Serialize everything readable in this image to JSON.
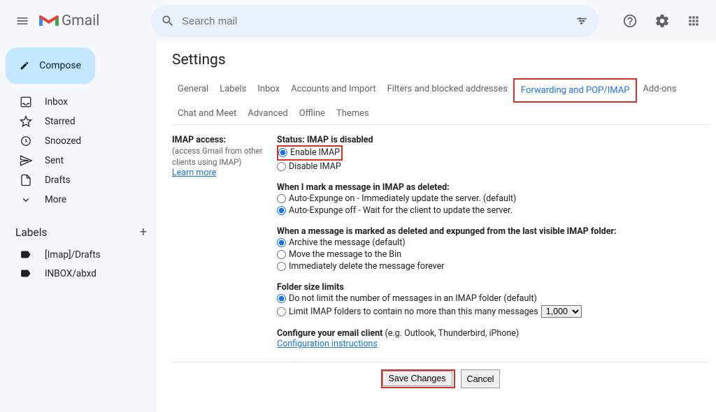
{
  "header": {
    "logo_text": "Gmail",
    "search_placeholder": "Search mail"
  },
  "compose_label": "Compose",
  "nav": {
    "inbox": "Inbox",
    "starred": "Starred",
    "snoozed": "Snoozed",
    "sent": "Sent",
    "drafts": "Drafts",
    "more": "More"
  },
  "labels_header": "Labels",
  "labels": {
    "imap_drafts": "[Imap]/Drafts",
    "inbox_abxd": "INBOX/abxd"
  },
  "settings_title": "Settings",
  "tabs": {
    "general": "General",
    "labels": "Labels",
    "inbox": "Inbox",
    "accounts": "Accounts and Import",
    "filters": "Filters and blocked addresses",
    "forwarding": "Forwarding and POP/IMAP",
    "addons": "Add-ons",
    "chat": "Chat and Meet",
    "advanced": "Advanced",
    "offline": "Offline",
    "themes": "Themes"
  },
  "imap": {
    "section_label": "IMAP access:",
    "section_hint": "(access Gmail from other clients using IMAP)",
    "learn_more": "Learn more",
    "status": "Status: IMAP is disabled",
    "enable": "Enable IMAP",
    "disable": "Disable IMAP",
    "deleted_header": "When I mark a message in IMAP as deleted:",
    "auto_on": "Auto-Expunge on - Immediately update the server. (default)",
    "auto_off": "Auto-Expunge off - Wait for the client to update the server.",
    "expunge_header": "When a message is marked as deleted and expunged from the last visible IMAP folder:",
    "archive": "Archive the message (default)",
    "move_bin": "Move the message to the Bin",
    "delete_forever": "Immediately delete the message forever",
    "folder_header": "Folder size limits",
    "no_limit": "Do not limit the number of messages in an IMAP folder (default)",
    "limit": "Limit IMAP folders to contain no more than this many messages",
    "limit_value": "1,000",
    "configure_client": "Configure your email client",
    "configure_examples": " (e.g. Outlook, Thunderbird, iPhone)",
    "config_instructions": "Configuration instructions"
  },
  "buttons": {
    "save": "Save Changes",
    "cancel": "Cancel"
  }
}
